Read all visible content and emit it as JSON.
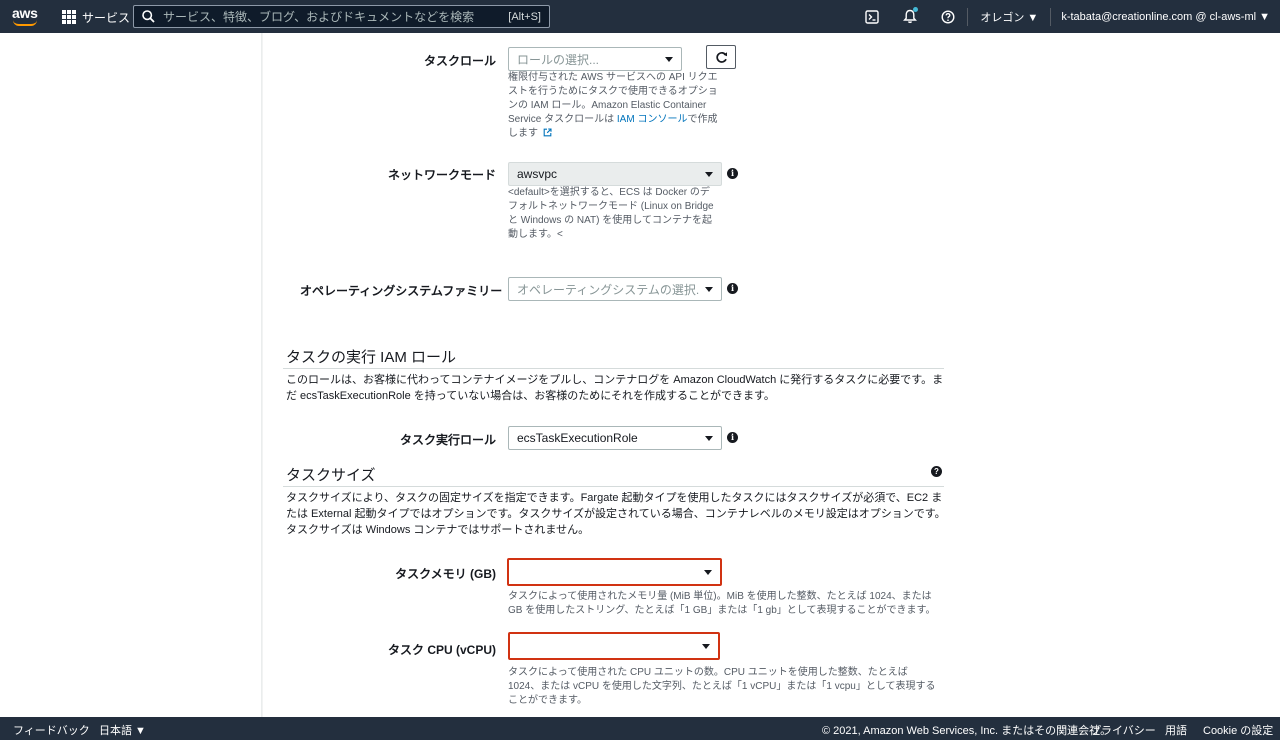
{
  "nav": {
    "logo": "aws",
    "services": "サービス",
    "search_placeholder": "サービス、特徴、ブログ、およびドキュメントなどを検索",
    "search_shortcut": "[Alt+S]",
    "region": "オレゴン ▼",
    "account": "k-tabata@creationline.com @ cl-aws-ml ▼",
    "icons": [
      "cloudshell-icon",
      "bell-icon",
      "help-icon"
    ],
    "accent": "#ff9900"
  },
  "form": {
    "task_role": {
      "label": "タスクロール",
      "placeholder": "ロールの選択...",
      "help_1": "権限付与された AWS サービスへの API リクエストを行うためにタスクで使用できるオプションの IAM ロール。Amazon Elastic Container Service タスクロールは ",
      "help_link": "IAM コンソール",
      "help_2": "で作成します"
    },
    "network_mode": {
      "label": "ネットワークモード",
      "value": "awsvpc",
      "help": "<default>を選択すると、ECS は Docker のデフォルトネットワークモード (Linux on Bridge と Windows の NAT) を使用してコンテナを起動します。<"
    },
    "os_family": {
      "label": "オペレーティングシステムファミリー",
      "placeholder": "オペレーティングシステムの選択..."
    },
    "exec_role_section": {
      "title": "タスクの実行 IAM ロール",
      "desc": "このロールは、お客様に代わってコンテナイメージをプルし、コンテナログを Amazon CloudWatch に発行するタスクに必要です。まだ ecsTaskExecutionRole を持っていない場合は、お客様のためにそれを作成することができます。"
    },
    "exec_role": {
      "label": "タスク実行ロール",
      "value": "ecsTaskExecutionRole"
    },
    "task_size_section": {
      "title": "タスクサイズ",
      "desc": "タスクサイズにより、タスクの固定サイズを指定できます。Fargate 起動タイプを使用したタスクにはタスクサイズが必須で、EC2 または External 起動タイプではオプションです。タスクサイズが設定されている場合、コンテナレベルのメモリ設定はオプションです。タスクサイズは Windows コンテナではサポートされません。"
    },
    "task_memory": {
      "label": "タスクメモリ (GB)",
      "value": "",
      "help": "タスクによって使用されたメモリ量 (MiB 単位)。MiB を使用した整数、たとえば 1024、または GB を使用したストリング、たとえば「1 GB」または「1 gb」として表現することができます。"
    },
    "task_cpu": {
      "label": "タスク CPU (vCPU)",
      "value": "",
      "help": "タスクによって使用された CPU ユニットの数。CPU ユニットを使用した整数、たとえば 1024、または vCPU を使用した文字列、たとえば「1 vCPU」または「1 vcpu」として表現することができます。"
    },
    "highlight_color": "#d13212"
  },
  "footer": {
    "feedback": "フィードバック",
    "language": "日本語 ▼",
    "copyright": "© 2021, Amazon Web Services, Inc. またはその関連会社。",
    "privacy": "プライバシー",
    "terms": "用語",
    "cookie": "Cookie の設定"
  }
}
